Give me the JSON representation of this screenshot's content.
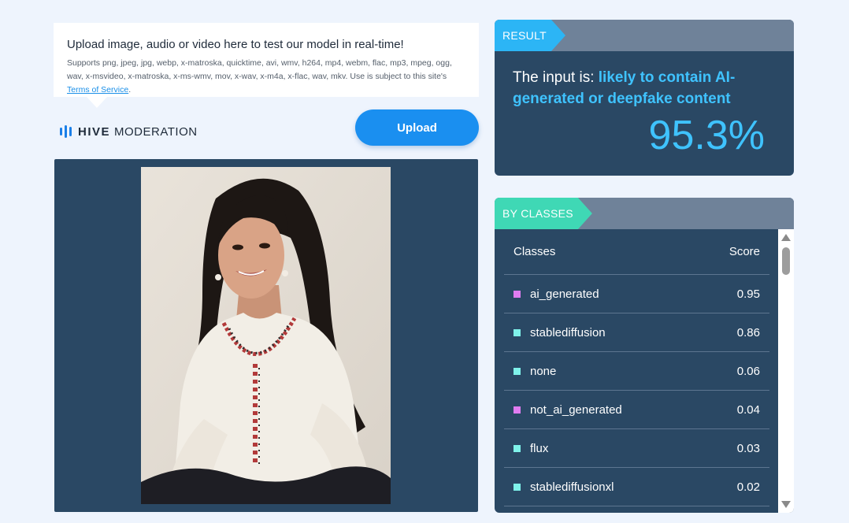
{
  "upload": {
    "title": "Upload image, audio or video here to test our model in real-time!",
    "description": "Supports png, jpeg, jpg, webp, x-matroska, quicktime, avi, wmv, h264, mp4, webm, flac, mp3, mpeg, ogg, wav, x-msvideo, x-matroska, x-ms-wmv, mov, x-wav, x-m4a, x-flac, wav, mkv. Use is subject to this site's ",
    "tos_link": "Terms of Service",
    "tos_suffix": ".",
    "button_label": "Upload"
  },
  "brand": {
    "hive": "HIVE",
    "moderation": "MODERATION",
    "logo_icon": "hive-bars-icon"
  },
  "result": {
    "tag": "RESULT",
    "prefix": "The input is: ",
    "verdict": "likely to contain AI-generated or deepfake content",
    "score": "95.3%"
  },
  "classes": {
    "tag": "BY CLASSES",
    "header_class": "Classes",
    "header_score": "Score",
    "rows": [
      {
        "name": "ai_generated",
        "score": "0.95",
        "color": "#e07cf0"
      },
      {
        "name": "stablediffusion",
        "score": "0.86",
        "color": "#7ff2ea"
      },
      {
        "name": "none",
        "score": "0.06",
        "color": "#7ff2ea"
      },
      {
        "name": "not_ai_generated",
        "score": "0.04",
        "color": "#e07cf0"
      },
      {
        "name": "flux",
        "score": "0.03",
        "color": "#7ff2ea"
      },
      {
        "name": "stablediffusionxl",
        "score": "0.02",
        "color": "#7ff2ea"
      }
    ]
  },
  "colors": {
    "accent": "#1a8ff0",
    "panel": "#2a4864",
    "result_highlight": "#3fc3ff",
    "result_tag": "#2cb5f5",
    "classes_tag": "#3fd8b5"
  }
}
